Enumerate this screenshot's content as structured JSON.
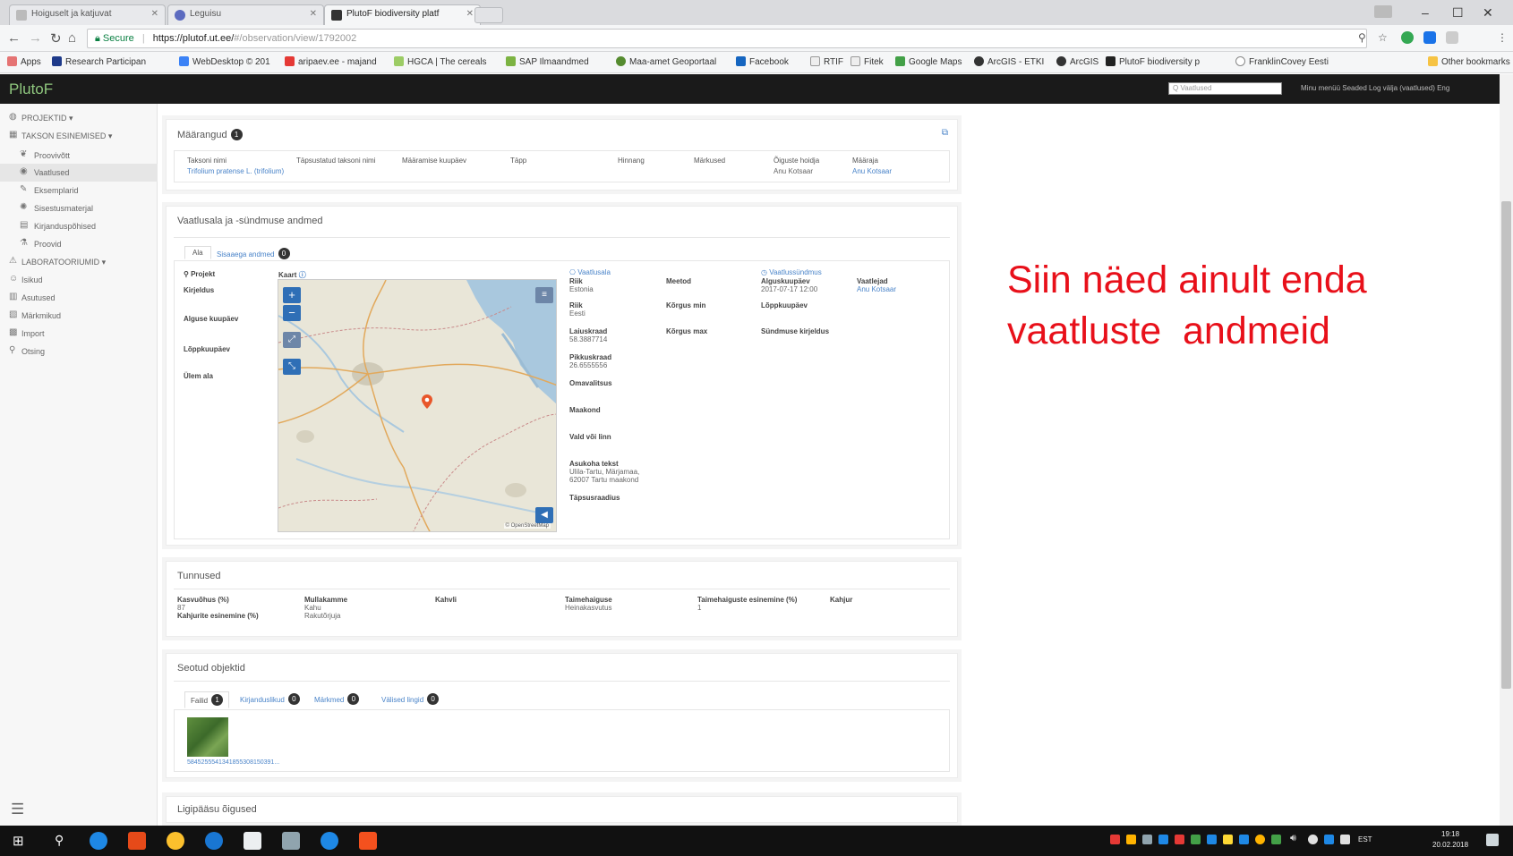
{
  "browser": {
    "tabs": [
      {
        "label": "Hoiguselt ja katjuvat"
      },
      {
        "label": "Leguisu"
      },
      {
        "label": "PlutoF biodiversity platf"
      }
    ],
    "address": {
      "secure_label": "Secure",
      "host": "https://plutof.ut.ee/",
      "path": "#/observation/view/1792002"
    },
    "bookmarks": [
      "Apps",
      "Research Participan",
      "WebDesktop © 201",
      "aripaev.ee - majand",
      "HGCA | The cereals",
      "SAP Ilmaandmed",
      "Maa-amet Geoportaal",
      "Facebook",
      "RTIF",
      "Fitek",
      "Google Maps",
      "ArcGIS - ETKI",
      "ArcGIS",
      "PlutoF biodiversity p",
      "FranklinCovey Eesti",
      "Other bookmarks"
    ]
  },
  "header": {
    "brand": "PlutoF",
    "search_placeholder": "Q Vaatlused",
    "links": "Minu menüü  Seaded  Log välja (vaatlused) Eng"
  },
  "sidebar": {
    "items": [
      {
        "label": "PROJEKTID ▾",
        "icon": "globe-icon"
      },
      {
        "label": "TAKSON ESINEMISED ▾",
        "icon": "grid-icon"
      },
      {
        "label": "Proovivõtt",
        "icon": "leaf-icon"
      },
      {
        "label": "Vaatlused",
        "icon": "binoculars-icon"
      },
      {
        "label": "Eksemplarid",
        "icon": "pin-icon"
      },
      {
        "label": "Sisestusmaterjal",
        "icon": "dna-icon"
      },
      {
        "label": "Kirjanduspõhised",
        "icon": "table-icon"
      },
      {
        "label": "Proovid",
        "icon": "flask-icon"
      },
      {
        "label": "LABORATOORIUMID ▾",
        "icon": "lab-icon"
      },
      {
        "label": "Isikud",
        "icon": "people-icon"
      },
      {
        "label": "Asutused",
        "icon": "building-icon"
      },
      {
        "label": "Märkmikud",
        "icon": "book-icon"
      },
      {
        "label": "Import",
        "icon": "import-icon"
      },
      {
        "label": "Otsing",
        "icon": "search-icon"
      }
    ]
  },
  "determinations": {
    "title": "Määrangud",
    "count": "1",
    "columns": [
      "Taksoni nimi",
      "Täpsustatud taksoni nimi",
      "Määramise kuupäev",
      "Täpp",
      "Hinnang",
      "Märkused",
      "Õiguste hoidja",
      "Määraja"
    ],
    "row": {
      "taxon": "Trifolium pratense L. (trifolium)",
      "rights": "Anu Kotsaar",
      "determiner": "Anu Kotsaar"
    }
  },
  "observation": {
    "title": "Vaatlusala ja -sündmuse andmed",
    "tabs": [
      {
        "label": "Ala"
      },
      {
        "label": "Sisaaega andmed",
        "count": "0"
      }
    ],
    "left_labels": [
      "Projekt",
      "Kirjeldus",
      "Alguse kuupäev",
      "Lõppkuupäev",
      "Ülem ala"
    ],
    "map_label": "Kaart",
    "locality": {
      "header": "Vaatlusala",
      "fields": [
        {
          "label": "Riik",
          "value": "Estonia"
        },
        {
          "label": "Riik",
          "value": "Eesti"
        },
        {
          "label": "Laiuskraad",
          "value": "58.3887714"
        },
        {
          "label": "Pikkuskraad",
          "value": "26.6555556"
        },
        {
          "label": "Omavalitsus",
          "value": ""
        },
        {
          "label": "Maakond",
          "value": ""
        },
        {
          "label": "Vald või linn",
          "value": ""
        },
        {
          "label": "Asukoha tekst",
          "value": "Ulila-Tartu, Märjamaa, 62007 Tartu maakond"
        },
        {
          "label": "Täpsusraadius",
          "value": ""
        }
      ],
      "mid_labels": [
        "Meetod",
        "Kõrgus min",
        "Kõrgus max"
      ]
    },
    "event": {
      "header": "Vaatlussündmus",
      "fields": [
        {
          "label": "Alguskuupäev",
          "value": "2017-07-17 12:00"
        },
        {
          "label": "Lõppkuupäev",
          "value": ""
        },
        {
          "label": "Sündmuse kirjeldus",
          "value": ""
        }
      ],
      "observer_label": "Vaatlejad",
      "observer": "Anu Kotsaar"
    },
    "map_attribution": "© OpenStreetMap"
  },
  "traits": {
    "title": "Tunnused",
    "items": [
      {
        "label": "Kasvuõhus (%)",
        "value": "87"
      },
      {
        "label": "Mullakamme",
        "value": "Kahu"
      },
      {
        "label": "Kahvli",
        "value": ""
      },
      {
        "label": "Taimehaiguse",
        "value": "Heinakasvutus"
      },
      {
        "label": "Taimehaiguste esinemine (%)",
        "value": "1"
      },
      {
        "label": "Kahjur",
        "value": ""
      }
    ],
    "extra": [
      {
        "label": "Kahjurite esinemine (%)",
        "value": "Rakutõrjuja"
      }
    ]
  },
  "related": {
    "title": "Seotud objektid",
    "tabs": [
      {
        "label": "Failid",
        "count": "1"
      },
      {
        "label": "Kirjanduslikud",
        "count": "0"
      },
      {
        "label": "Märkmed",
        "count": "0"
      },
      {
        "label": "Välised lingid",
        "count": "0"
      }
    ],
    "file_caption": "5845255541341855308150391..."
  },
  "permissions": {
    "title": "Ligipääsu õigused"
  },
  "overlay": {
    "line1": "Siin näed ainult enda",
    "line2": "vaatluste  andmeid"
  },
  "taskbar": {
    "time": "19:18",
    "date": "20.02.2018",
    "lang": "EST"
  },
  "colors": {
    "accent": "#4a84c9",
    "overlay": "#e8101a",
    "brand": "#8fc77e"
  }
}
